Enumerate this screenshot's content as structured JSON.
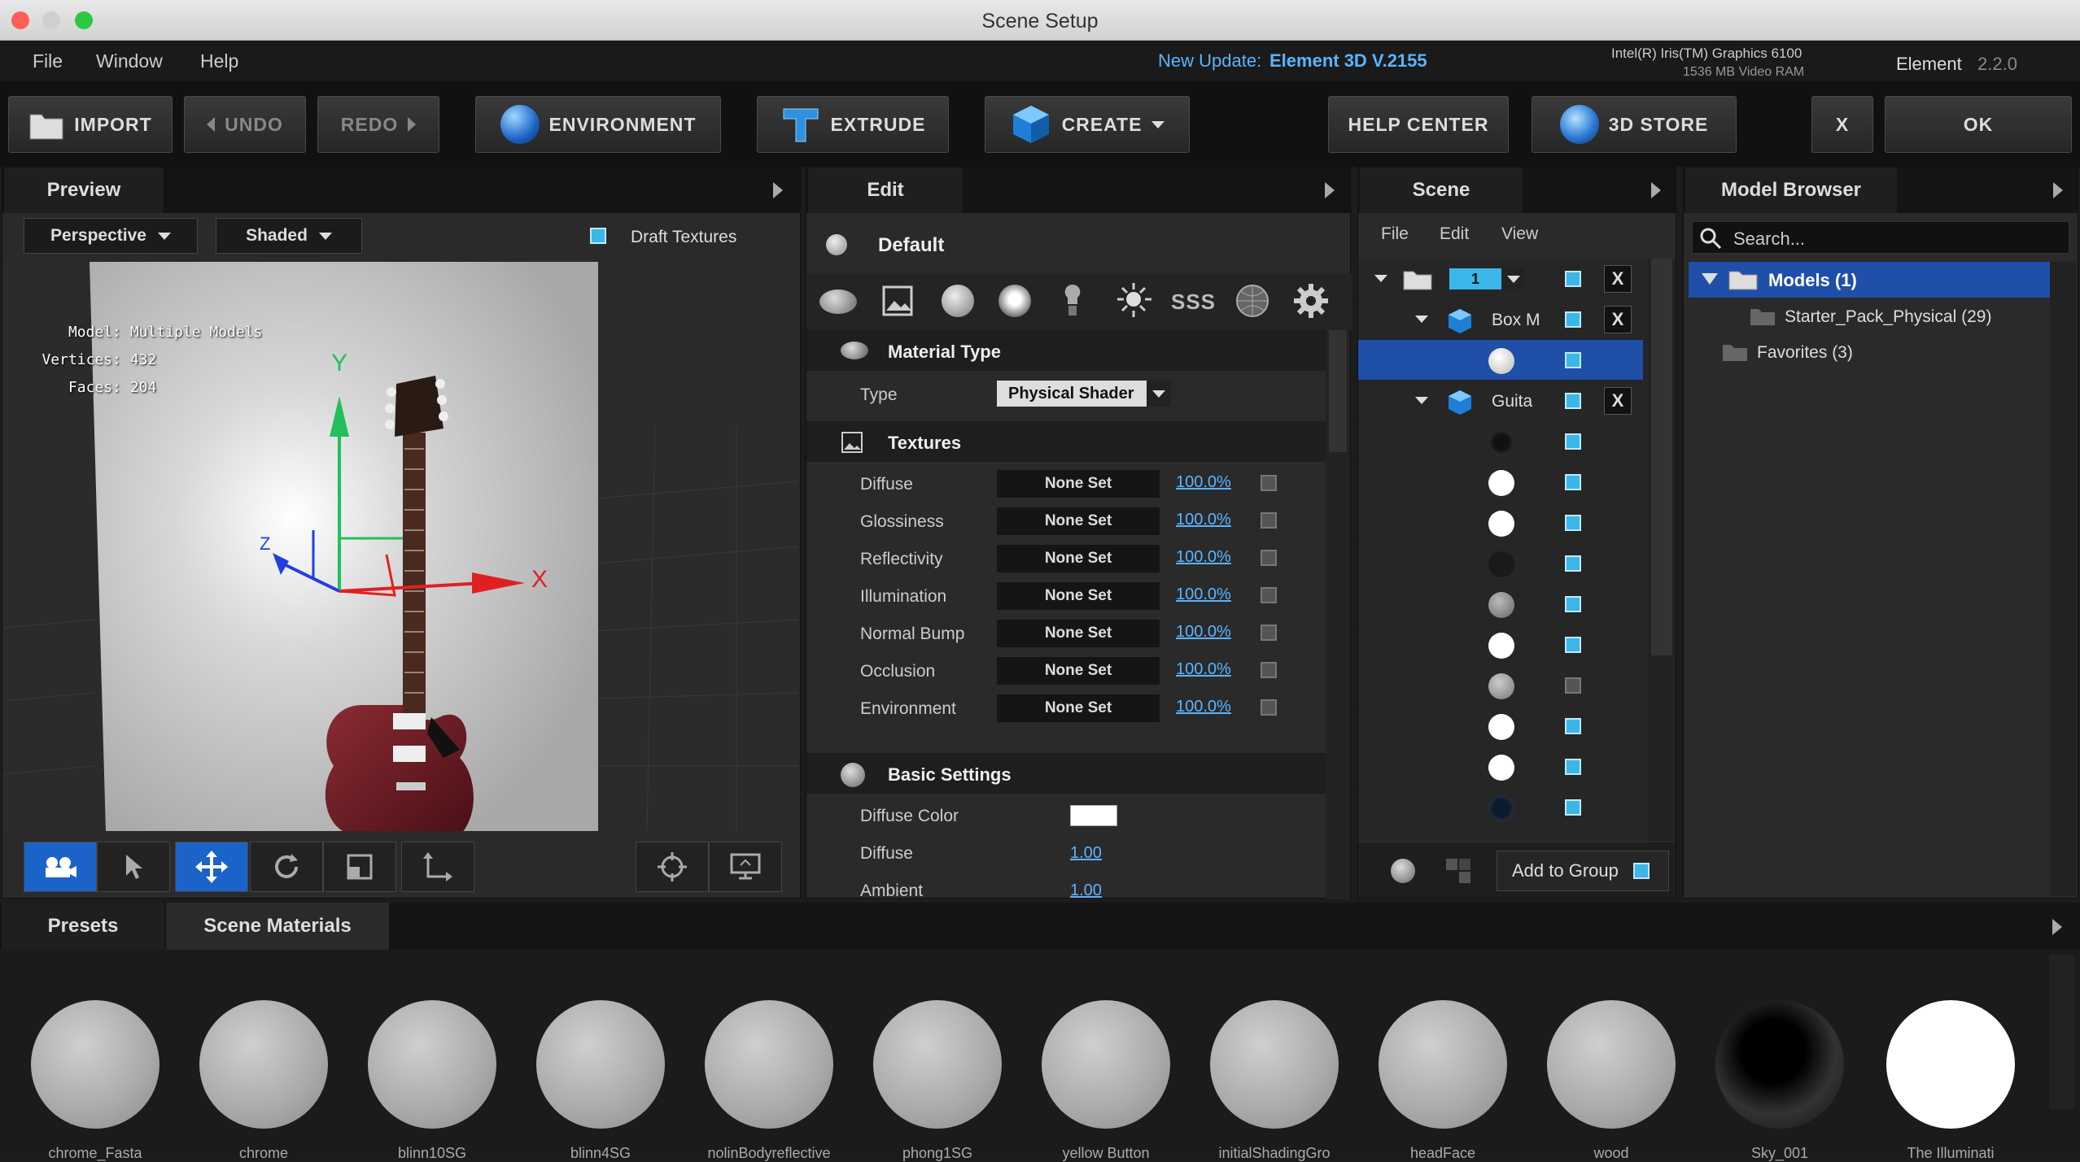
{
  "window": {
    "title": "Scene Setup"
  },
  "menu": [
    "File",
    "Window",
    "Help"
  ],
  "update": {
    "label": "New Update:",
    "value": "Element 3D V.2155"
  },
  "gpu": {
    "name": "Intel(R) Iris(TM) Graphics 6100",
    "vram": "1536 MB Video RAM"
  },
  "app": {
    "name": "Element",
    "version": "2.2.0"
  },
  "toolbar": {
    "import": "IMPORT",
    "undo": "UNDO",
    "redo": "REDO",
    "environment": "ENVIRONMENT",
    "extrude": "EXTRUDE",
    "create": "CREATE",
    "help": "HELP CENTER",
    "store": "3D STORE",
    "close": "X",
    "ok": "OK"
  },
  "preview": {
    "tab": "Preview",
    "view": "Perspective",
    "shading": "Shaded",
    "draft": "Draft Textures",
    "stats": [
      {
        "k": "Model:",
        "v": "Multiple Models"
      },
      {
        "k": "Vertices:",
        "v": "432"
      },
      {
        "k": "Faces:",
        "v": "204"
      }
    ],
    "axes": {
      "x": "X",
      "y": "Y",
      "z": "Z"
    }
  },
  "edit": {
    "tab": "Edit",
    "material": "Default",
    "material_type": "Material Type",
    "type_label": "Type",
    "type_value": "Physical Shader",
    "textures": "Textures",
    "texture_rows": [
      {
        "label": "Diffuse",
        "value": "None Set",
        "pct": "100.0%"
      },
      {
        "label": "Glossiness",
        "value": "None Set",
        "pct": "100.0%"
      },
      {
        "label": "Reflectivity",
        "value": "None Set",
        "pct": "100.0%"
      },
      {
        "label": "Illumination",
        "value": "None Set",
        "pct": "100.0%"
      },
      {
        "label": "Normal Bump",
        "value": "None Set",
        "pct": "100.0%"
      },
      {
        "label": "Occlusion",
        "value": "None Set",
        "pct": "100.0%"
      },
      {
        "label": "Environment",
        "value": "None Set",
        "pct": "100.0%"
      }
    ],
    "basic": "Basic Settings",
    "diffuse_color": "Diffuse Color",
    "diffuse": "Diffuse",
    "diffuse_val": "1.00",
    "ambient": "Ambient",
    "ambient_val": "1.00",
    "icons_sss": "SSS"
  },
  "scene": {
    "tab": "Scene",
    "menu": [
      "File",
      "Edit",
      "View"
    ],
    "group_num": "1",
    "box": "Box M",
    "guitar": "Guita",
    "add_group": "Add to Group"
  },
  "browser": {
    "tab": "Model Browser",
    "search": "Search...",
    "models": "Models (1)",
    "starter": "Starter_Pack_Physical (29)",
    "favorites": "Favorites (3)"
  },
  "bottom": {
    "presets": "Presets",
    "scene_materials": "Scene Materials",
    "materials": [
      "chrome_Fasta",
      "chrome",
      "blinn10SG",
      "blinn4SG",
      "nolinBodyreflective",
      "phong1SG",
      "yellow Button",
      "initialShadingGro",
      "headFace",
      "wood",
      "Sky_001",
      "The Illuminati"
    ]
  },
  "colors": {
    "accent": "#3bb6e8",
    "selected": "#1f4fa8",
    "link": "#5ab4ff"
  }
}
